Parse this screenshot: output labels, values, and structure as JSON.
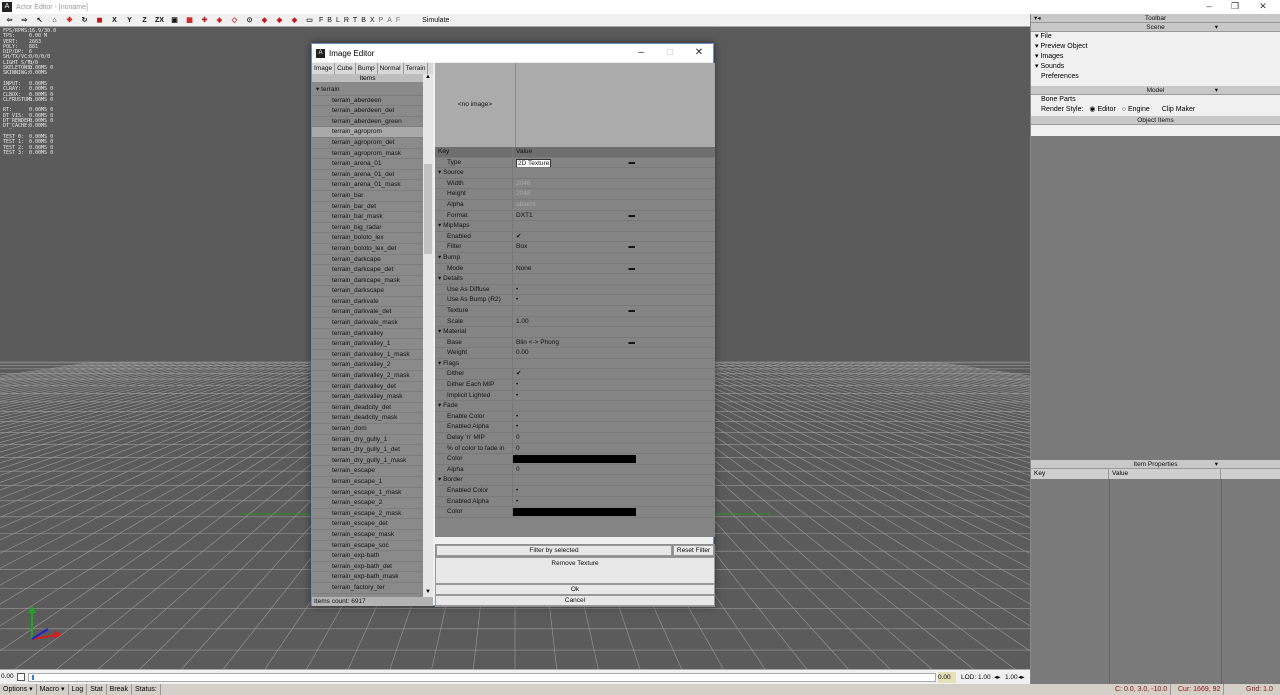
{
  "window": {
    "title": "Actor Editor - [noname]",
    "app_icon": "app-logo-icon"
  },
  "toolbar": {
    "axes": [
      "X",
      "Y",
      "Z",
      "ZX"
    ],
    "flags": [
      "F",
      "B",
      "L",
      "R",
      "T",
      "B",
      "X"
    ],
    "modes": [
      "P",
      "A",
      "F"
    ],
    "simulate_label": "Simulate"
  },
  "stats": [
    [
      "FPS/RPMS:",
      "16.9/30.0"
    ],
    [
      "TPS:",
      "0.00 M"
    ],
    [
      "VERT:",
      "2663"
    ],
    [
      "POLY:",
      "881"
    ],
    [
      "DIP/DP:",
      "6"
    ],
    [
      "SH/TX/VC:",
      "0/0/0/0"
    ],
    [
      "LIGHT S/T:",
      "0/0"
    ],
    [
      "SKELETONS:",
      "0.00MS 0"
    ],
    [
      "SKINNING:",
      "0.00MS"
    ],
    [
      "",
      ""
    ],
    [
      "INPUT:",
      "0.00MS"
    ],
    [
      "CLRAY:",
      "0.00MS 0"
    ],
    [
      "CLBOX:",
      "0.00MS 0"
    ],
    [
      "CLFRUSTUM:",
      "0.00MS 0"
    ],
    [
      "",
      ""
    ],
    [
      "RT:",
      "0.00MS 0"
    ],
    [
      "DT_VIS:",
      "0.00MS 0"
    ],
    [
      "DT_RENDER:",
      "0.00MS 0"
    ],
    [
      "DT_CACHE:",
      "0.00MS"
    ],
    [
      "",
      ""
    ],
    [
      "TEST 0:",
      "0.00MS 0"
    ],
    [
      "TEST 1:",
      "0.00MS 0"
    ],
    [
      "TEST 2:",
      "0.00MS 0"
    ],
    [
      "TEST 3:",
      "0.00MS 0"
    ]
  ],
  "timeline": {
    "left_value": "0.00",
    "right_value": "0.00",
    "lod_label": "LOD: 1.00",
    "speed": "1.00"
  },
  "statusbar": {
    "items": [
      "Options",
      "Macro",
      "Log",
      "Stat",
      "Break",
      "Status:"
    ],
    "cursor": "C: 0.0, 3.0, -10.0",
    "cur": "Cur: 1669, 92",
    "grid": "Grid: 1.0"
  },
  "right_panel": {
    "toolbar_title": "Toolbar",
    "scene_title": "Scene",
    "scene_items": [
      "File",
      "Preview Object",
      "Images",
      "Sounds",
      "Preferences"
    ],
    "model_title": "Model",
    "bone_parts": "Bone Parts",
    "render_style_label": "Render Style:",
    "render_editor": "Editor",
    "render_engine": "Engine",
    "clip_maker": "Clip Maker",
    "object_items": "Object Items",
    "item_properties": "Item Properties",
    "key_col": "Key",
    "value_col": "Value"
  },
  "dialog": {
    "title": "Image Editor",
    "tabs": [
      "Image",
      "Cube",
      "Bump",
      "Normal",
      "Terrain"
    ],
    "items_header": "Items",
    "group": "terrain",
    "items": [
      "terrain_aberdeen",
      "terrain_aberdeen_det",
      "terrain_aberdeen_green",
      "terrain_agroprom",
      "terrain_agroprom_det",
      "terrain_agroprom_mask",
      "terrain_arena_01",
      "terrain_arena_01_det",
      "terrain_arena_01_mask",
      "terrain_bar",
      "terrain_bar_det",
      "terrain_bar_mask",
      "terrain_big_radar",
      "terrain_boloto_lex",
      "terrain_boloto_lex_det",
      "terrain_darkcape",
      "terrain_darkcape_det",
      "terrain_darkcape_mask",
      "terrain_darkscape",
      "terrain_darkvale",
      "terrain_darkvale_det",
      "terrain_darkvale_mask",
      "terrain_darkvalley",
      "terrain_darkvalley_1",
      "terrain_darkvalley_1_mask",
      "terrain_darkvalley_2",
      "terrain_darkvalley_2_mask",
      "terrain_darkvalley_det",
      "terrain_darkvalley_mask",
      "terrain_deadcity_det",
      "terrain_deadcity_mask",
      "terrain_dom",
      "terrain_dry_gully_1",
      "terrain_dry_gully_1_det",
      "terrain_dry_gully_1_mask",
      "terrain_escape",
      "terrain_escape_1",
      "terrain_escape_1_mask",
      "terrain_escape_2",
      "terrain_escape_2_mask",
      "terrain_escape_det",
      "terrain_escape_mask",
      "terrain_escape_soc",
      "terrain_exp-bath",
      "terrain_exp-bath_det",
      "terrain_exp-bath_mask",
      "terrain_factory_ter"
    ],
    "selected_item": "terrain_agroprom",
    "items_count": "Items count: 6917",
    "no_image": "<no image>",
    "props_key": "Key",
    "props_value": "Value",
    "props": [
      {
        "k": "Type",
        "v": "2D Texture",
        "kind": "boxed",
        "dash": true
      },
      {
        "k": "Source",
        "kind": "section"
      },
      {
        "k": "Width",
        "v": "2048",
        "kind": "dim"
      },
      {
        "k": "Height",
        "v": "2048",
        "kind": "dim"
      },
      {
        "k": "Alpha",
        "v": "absent",
        "kind": "dim"
      },
      {
        "k": "Format",
        "v": "DXT1",
        "dash": true
      },
      {
        "k": "MipMaps",
        "kind": "section"
      },
      {
        "k": "Enabled",
        "v": "✔"
      },
      {
        "k": "Filter",
        "v": "Box",
        "dash": true
      },
      {
        "k": "Bump",
        "kind": "section"
      },
      {
        "k": "Mode",
        "v": "None",
        "dash": true
      },
      {
        "k": "Details",
        "kind": "section"
      },
      {
        "k": "Use As Diffuse",
        "v": "•"
      },
      {
        "k": "Use As Bump (R2)",
        "v": "•"
      },
      {
        "k": "Texture",
        "v": "",
        "dash": true
      },
      {
        "k": "Scale",
        "v": "1.00"
      },
      {
        "k": "Material",
        "kind": "section"
      },
      {
        "k": "Base",
        "v": "Blin <-> Phong",
        "dash": true
      },
      {
        "k": "Weight",
        "v": "0.00"
      },
      {
        "k": "Flags",
        "kind": "section"
      },
      {
        "k": "Dither",
        "v": "✔"
      },
      {
        "k": "Dither Each MIP",
        "v": "•"
      },
      {
        "k": "Implicit Lighted",
        "v": "•"
      },
      {
        "k": "Fade",
        "kind": "section"
      },
      {
        "k": "Enable Color",
        "v": "•"
      },
      {
        "k": "Enabled Alpha",
        "v": "•"
      },
      {
        "k": "Delay 'n' MIP",
        "v": "0"
      },
      {
        "k": "% of color to fade in",
        "v": "0"
      },
      {
        "k": "Color",
        "v": "",
        "kind": "black"
      },
      {
        "k": "Alpha",
        "v": "0"
      },
      {
        "k": "Border",
        "kind": "section"
      },
      {
        "k": "Enabled Color",
        "v": "•"
      },
      {
        "k": "Enabled Alpha",
        "v": "•"
      },
      {
        "k": "Color",
        "v": "",
        "kind": "black"
      }
    ],
    "filter_btn": "Filter by selected",
    "reset_filter_btn": "Reset Filter",
    "remove_texture_btn": "Remove Texture",
    "ok_btn": "Ok",
    "cancel_btn": "Cancel"
  },
  "colors": {
    "grid_line": "#9a9a9a",
    "axis_y": "#1fa51f",
    "axis_x": "#d21e1e",
    "axis_z": "#1e1ed2",
    "selection": "#a9a9a9"
  }
}
